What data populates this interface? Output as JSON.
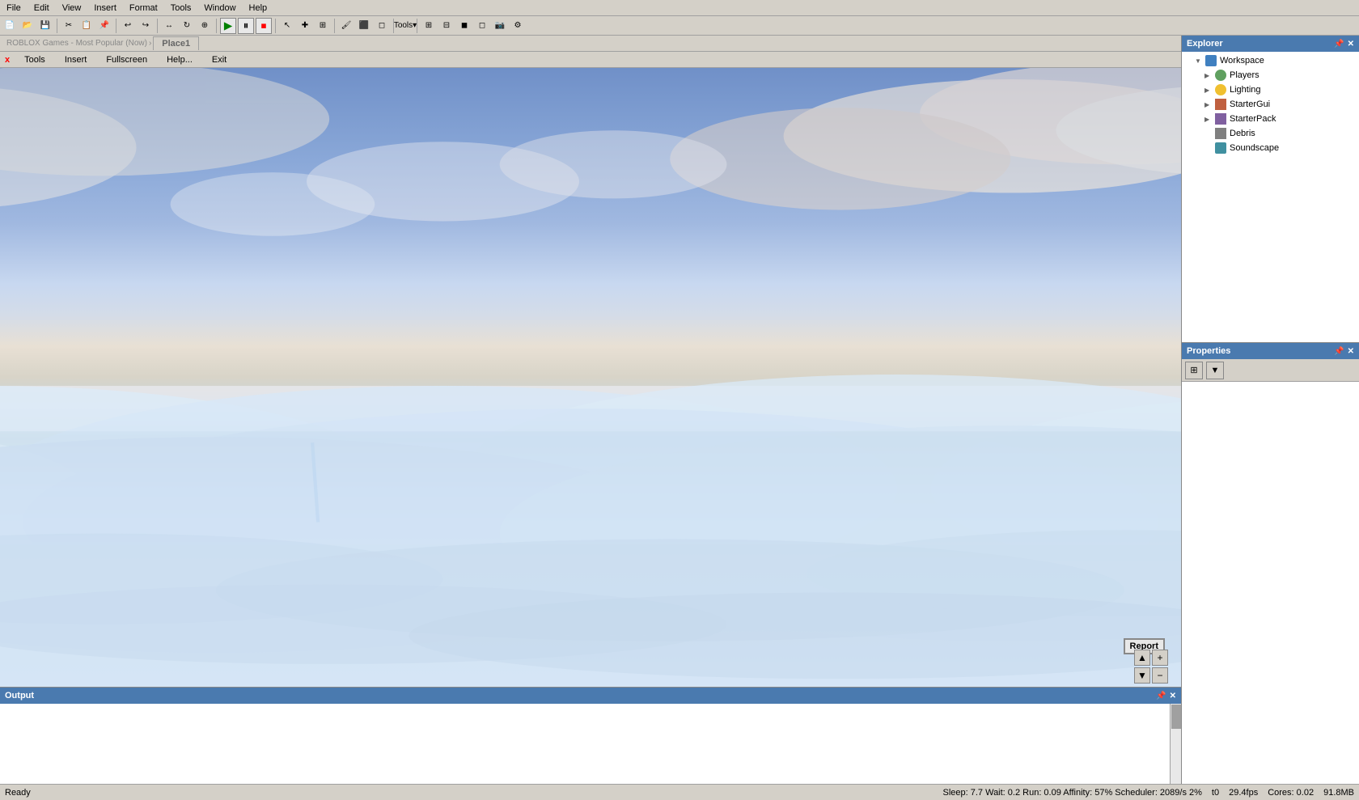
{
  "menubar": {
    "items": [
      "File",
      "Edit",
      "View",
      "Insert",
      "Format",
      "Tools",
      "Window",
      "Help"
    ]
  },
  "tab_bar": {
    "back_label": "ROBLOX Games - Most Popular (Now)",
    "active_tab": "Place1"
  },
  "game_menubar": {
    "close": "x",
    "items": [
      "Tools",
      "Insert",
      "Fullscreen",
      "Help...",
      "Exit"
    ]
  },
  "explorer": {
    "title": "Explorer",
    "items": [
      {
        "label": "Workspace",
        "icon": "workspace",
        "expanded": true,
        "indent": 0
      },
      {
        "label": "Players",
        "icon": "players",
        "indent": 1
      },
      {
        "label": "Lighting",
        "icon": "lighting",
        "indent": 1
      },
      {
        "label": "StarterGui",
        "icon": "startergui",
        "indent": 1
      },
      {
        "label": "StarterPack",
        "icon": "starterpack",
        "indent": 1
      },
      {
        "label": "Debris",
        "icon": "debris",
        "indent": 1
      },
      {
        "label": "Soundscape",
        "icon": "soundscape",
        "indent": 1
      }
    ]
  },
  "properties": {
    "title": "Properties",
    "sort_btn": "⊞",
    "filter_btn": "▼"
  },
  "output": {
    "title": "Output"
  },
  "statusbar": {
    "left": "Ready",
    "stats": "Sleep: 7.7  Wait: 0.2  Run: 0.09  Affinity: 57%  Scheduler: 2089/s 2%",
    "fps": "29.4fps",
    "cores": "Cores: 0.02",
    "t0": "t0",
    "memory": "91.8MB"
  },
  "report_btn": "Report",
  "viewport_controls": {
    "up": "▲",
    "plus": "+",
    "down": "▼",
    "minus": "−"
  }
}
